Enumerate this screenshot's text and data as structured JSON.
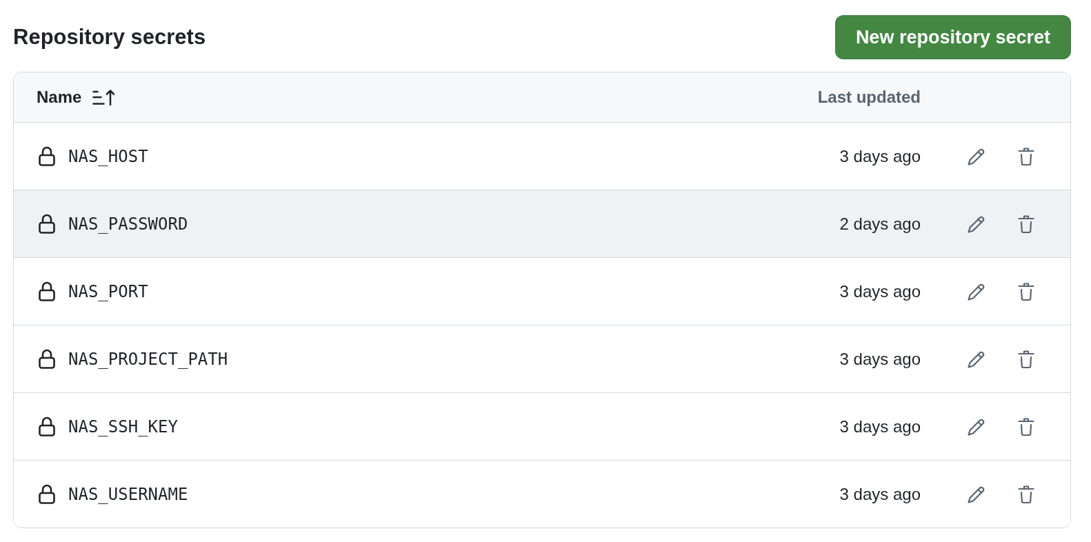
{
  "title": "Repository secrets",
  "new_secret_button": {
    "label": "New repository secret"
  },
  "table": {
    "columns": [
      {
        "label": "Name",
        "sorted": true
      },
      {
        "label": "Last updated",
        "sorted": false
      }
    ],
    "rows": [
      {
        "name": "NAS_HOST",
        "updated": "3 days ago",
        "highlighted": false
      },
      {
        "name": "NAS_PASSWORD",
        "updated": "2 days ago",
        "highlighted": true
      },
      {
        "name": "NAS_PORT",
        "updated": "3 days ago",
        "highlighted": false
      },
      {
        "name": "NAS_PROJECT_PATH",
        "updated": "3 days ago",
        "highlighted": false
      },
      {
        "name": "NAS_SSH_KEY",
        "updated": "3 days ago",
        "highlighted": false
      },
      {
        "name": "NAS_USERNAME",
        "updated": "3 days ago",
        "highlighted": false
      }
    ]
  }
}
